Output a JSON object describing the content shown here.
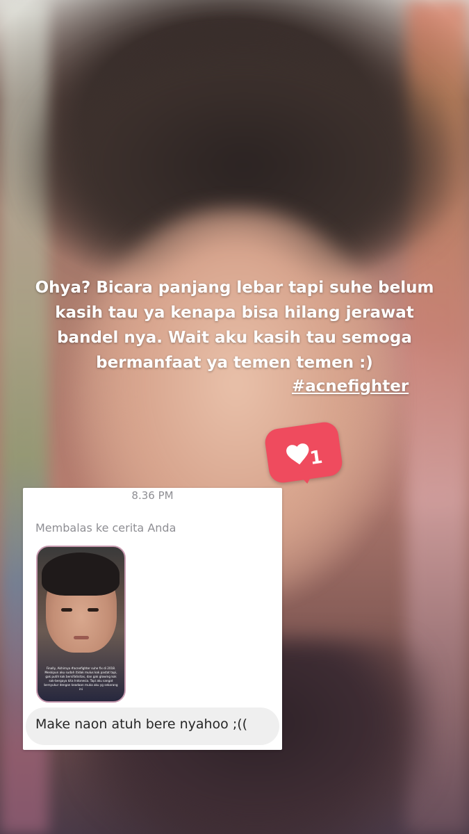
{
  "story": {
    "caption": "Ohya? Bicara panjang lebar tapi suhe belum kasih tau ya kenapa bisa hilang jerawat bandel nya. Wait aku kasih tau semoga bermanfaat ya temen temen :)",
    "hashtag": "#acnefighter",
    "like_sticker": {
      "count": "1",
      "color": "#ef4b5e"
    }
  },
  "dm": {
    "time": "8.36 PM",
    "reply_label": "Membalas ke cerita Anda",
    "thumbnail_caption": "Finally, Akhirnya #acnefighter suhe fix di 2018. Meskipun aku sudah (tidak mulus kok pastat tapi, gak putih kok bersifatisitas, dan gak glowing kok sok-bergaya kita Indonesia. Tapi aku sangat bersyukur dengan keadaan muka aku yg sekarang ini",
    "message": "Make naon atuh bere nyahoo ;(("
  }
}
